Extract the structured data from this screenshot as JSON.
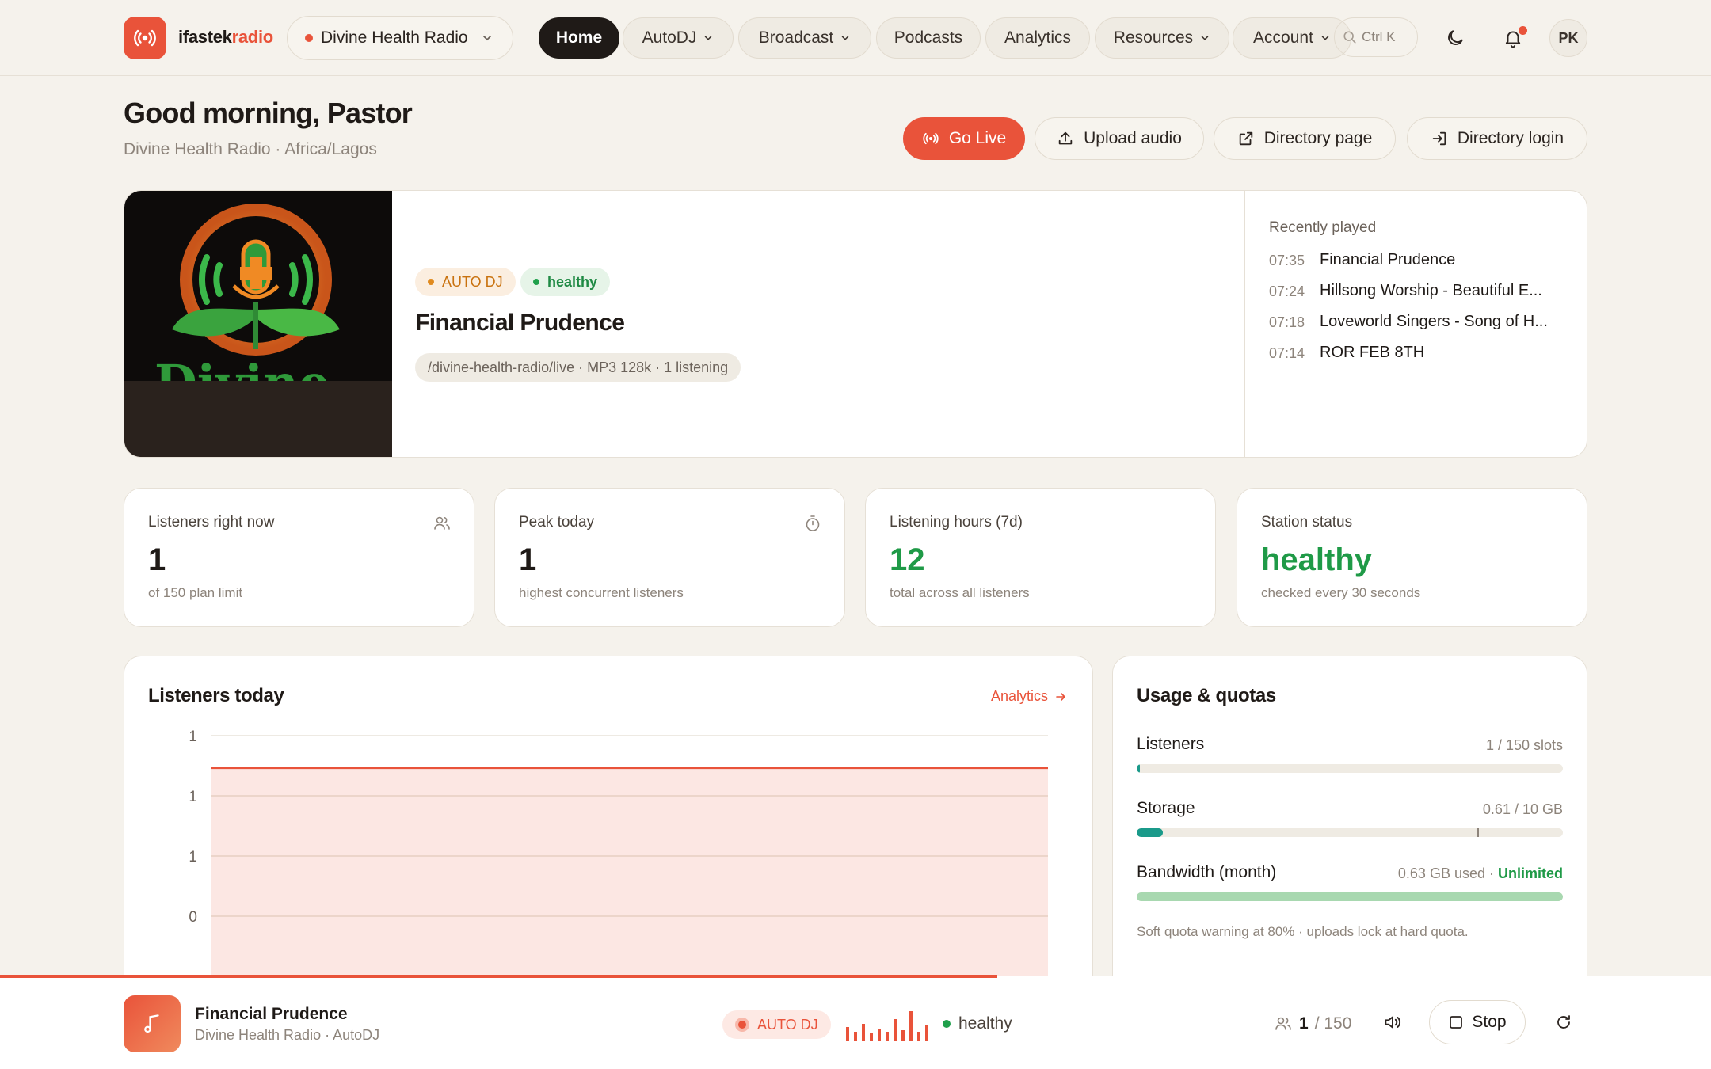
{
  "brand": {
    "name_main": "ifastek",
    "name_accent": "radio",
    "icon": "radio-broadcast-icon",
    "accent": "#e9533a"
  },
  "station_selector": {
    "label": "Divine Health Radio",
    "status": "live"
  },
  "nav": {
    "items": [
      {
        "label": "Home",
        "active": true
      },
      {
        "label": "AutoDJ",
        "dropdown": true
      },
      {
        "label": "Broadcast",
        "dropdown": true
      },
      {
        "label": "Podcasts"
      },
      {
        "label": "Analytics"
      },
      {
        "label": "Resources",
        "dropdown": true
      },
      {
        "label": "Account",
        "dropdown": true
      }
    ],
    "search_shortcut": "Ctrl K"
  },
  "user": {
    "initials": "PK",
    "has_notifications": true
  },
  "header": {
    "greeting": "Good morning, Pastor",
    "subtitle": "Divine Health Radio · Africa/Lagos",
    "actions": {
      "go_live": "Go Live",
      "upload": "Upload audio",
      "directory_page": "Directory page",
      "directory_login": "Directory login"
    }
  },
  "now_playing": {
    "mode_badge": "AUTO DJ",
    "health_badge": "healthy",
    "title": "Financial Prudence",
    "mount_info": "/divine-health-radio/live · MP3 128k · 1 listening",
    "cover_alt": "Divine Health Radio logo",
    "cover_text": "Divine"
  },
  "recently_played": {
    "title": "Recently played",
    "items": [
      {
        "time": "07:35",
        "title": "Financial Prudence"
      },
      {
        "time": "07:24",
        "title": "Hillsong Worship - Beautiful E..."
      },
      {
        "time": "07:18",
        "title": "Loveworld Singers - Song of H..."
      },
      {
        "time": "07:14",
        "title": "ROR FEB 8TH"
      }
    ]
  },
  "stats": [
    {
      "label": "Listeners right now",
      "value": "1",
      "sub": "of 150 plan limit",
      "icon": "users-icon"
    },
    {
      "label": "Peak today",
      "value": "1",
      "sub": "highest concurrent listeners",
      "icon": "stopwatch-icon"
    },
    {
      "label": "Listening hours (7d)",
      "value": "12",
      "sub": "total across all listeners"
    },
    {
      "label": "Station status",
      "value": "healthy",
      "sub": "checked every 30 seconds"
    }
  ],
  "listeners_chart": {
    "title": "Listeners today",
    "link": "Analytics",
    "y_ticks": [
      "1",
      "1",
      "1",
      "0"
    ]
  },
  "chart_data": {
    "type": "area",
    "title": "Listeners today",
    "xlabel": "",
    "ylabel": "",
    "y_tick_labels": [
      "1",
      "1",
      "1",
      "0"
    ],
    "ylim": [
      0,
      1.2
    ],
    "series": [
      {
        "values": [
          1,
          1,
          1,
          1,
          1,
          1,
          1,
          1,
          1,
          1
        ]
      }
    ],
    "grid": true,
    "color": "#e9533a"
  },
  "usage": {
    "title": "Usage & quotas",
    "quotas": [
      {
        "label": "Listeners",
        "value": "1 / 150 slots",
        "fraction": 0.0067,
        "color": "#1a9a8a"
      },
      {
        "label": "Storage",
        "value": "0.61 / 10 GB",
        "fraction": 0.061,
        "color": "#1a9a8a"
      },
      {
        "label": "Bandwidth (month)",
        "value": "0.63 GB used · ",
        "value_ok": "Unlimited",
        "fraction": 1.0,
        "color": "#a8d8b0"
      }
    ],
    "note": "Soft quota warning at 80% · uploads lock at hard quota."
  },
  "player": {
    "title": "Financial Prudence",
    "subtitle": "Divine Health Radio · AutoDJ",
    "mode": "AUTO DJ",
    "health": "healthy",
    "listeners_current": "1",
    "listeners_limit": "/ 150",
    "stop_label": "Stop",
    "progress_fraction": 0.583
  }
}
